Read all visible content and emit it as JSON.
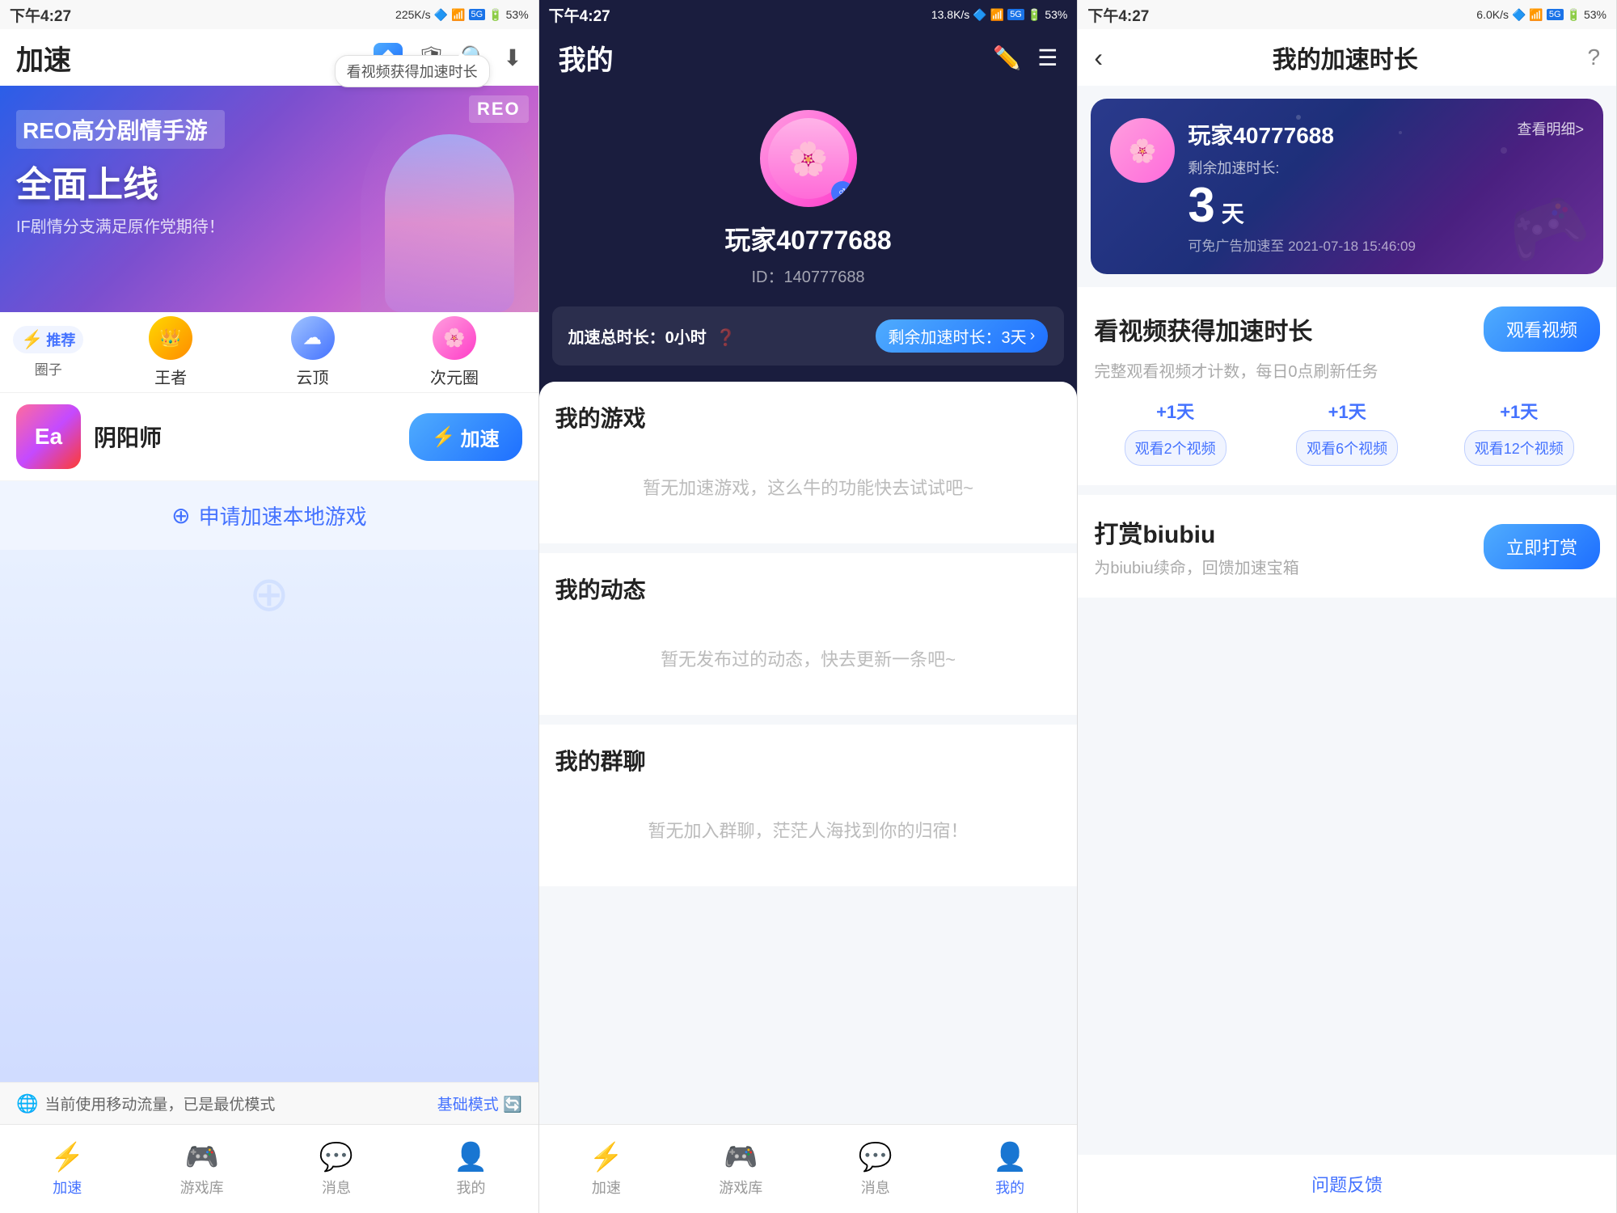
{
  "status": {
    "time": "下午4:27",
    "speed1": "225K/s",
    "speed2": "13.8K/s",
    "speed3": "6.0K/s",
    "battery": "53%",
    "signal": "5G"
  },
  "panel1": {
    "title": "加速",
    "speed_tip": "看视频获得加速时长",
    "banner": {
      "badge": "REO",
      "line1": "REO高分剧情手游",
      "line2": "全面上线",
      "line3": "IF剧情分支满足原作党期待！"
    },
    "circles": {
      "recommend": "推荐圈子",
      "items": [
        {
          "label": "王者"
        },
        {
          "label": "云顶"
        },
        {
          "label": "次元圈"
        }
      ]
    },
    "game": {
      "name": "阴阳师",
      "speed_btn": "加速"
    },
    "apply_text": "申请加速本地游戏",
    "nav": {
      "items": [
        {
          "label": "加速",
          "active": true
        },
        {
          "label": "游戏库",
          "active": false
        },
        {
          "label": "消息",
          "active": false
        },
        {
          "label": "我的",
          "active": false
        }
      ]
    },
    "bottom_status": {
      "left": "当前使用移动流量，已是最优模式",
      "right": "基础模式"
    }
  },
  "panel2": {
    "title": "我的",
    "username": "玩家40777688",
    "userid": "ID：140777688",
    "total_speed": "加速总时长：0小时",
    "remain_speed": "剩余加速时长：3天",
    "sections": {
      "my_games": {
        "title": "我的游戏",
        "empty": "暂无加速游戏，这么牛的功能快去试试吧~"
      },
      "my_posts": {
        "title": "我的动态",
        "empty": "暂无发布过的动态，快去更新一条吧~"
      },
      "my_groups": {
        "title": "我的群聊",
        "empty": "暂无加入群聊，茫茫人海找到你的归宿！"
      }
    },
    "nav": {
      "items": [
        {
          "label": "加速",
          "active": false
        },
        {
          "label": "游戏库",
          "active": false
        },
        {
          "label": "消息",
          "active": false
        },
        {
          "label": "我的",
          "active": true
        }
      ]
    }
  },
  "panel3": {
    "title": "我的加速时长",
    "user": {
      "name": "玩家40777688",
      "remain_label": "剩余加速时长:",
      "remain_days": "3",
      "remain_unit": "天",
      "expire_text": "可免广告加速至 2021-07-18 15:46:09",
      "view_detail": "查看明细>"
    },
    "watch_video": {
      "title": "看视频获得加速时长",
      "desc": "完整观看视频才计数，每日0点刷新任务",
      "btn": "观看视频",
      "tiers": [
        {
          "bonus": "+1天",
          "label": "观看2个视频"
        },
        {
          "bonus": "+1天",
          "label": "观看6个视频"
        },
        {
          "bonus": "+1天",
          "label": "观看12个视频"
        }
      ]
    },
    "reward": {
      "title": "打赏biubiu",
      "desc": "为biubiu续命，回馈加速宝箱",
      "btn": "立即打赏"
    },
    "feedback": "问题反馈"
  }
}
